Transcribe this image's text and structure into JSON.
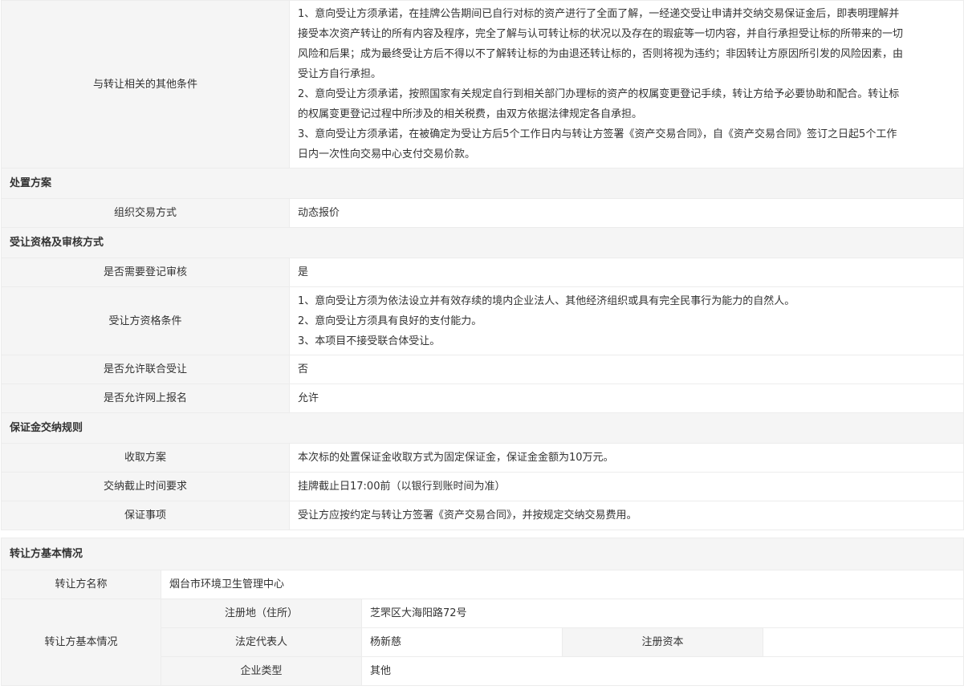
{
  "other_conditions": {
    "label": "与转让相关的其他条件",
    "lines": [
      "1、意向受让方须承诺，在挂牌公告期间已自行对标的资产进行了全面了解，一经递交受让申请并交纳交易保证金后，即表明理解并",
      "接受本次资产转让的所有内容及程序，完全了解与认可转让标的状况以及存在的瑕疵等一切内容，并自行承担受让标的所带来的一切",
      "风险和后果；成为最终受让方后不得以不了解转让标的为由退还转让标的，否则将视为违约；非因转让方原因所引发的风险因素，由",
      "受让方自行承担。",
      "2、意向受让方须承诺，按照国家有关规定自行到相关部门办理标的资产的权属变更登记手续，转让方给予必要协助和配合。转让标",
      "的权属变更登记过程中所涉及的相关税费，由双方依据法律规定各自承担。",
      "3、意向受让方须承诺，在被确定为受让方后5个工作日内与转让方签署《资产交易合同》，自《资产交易合同》签订之日起5个工作",
      "日内一次性向交易中心支付交易价款。"
    ]
  },
  "disposal": {
    "header": "处置方案",
    "method_label": "组织交易方式",
    "method_value": "动态报价"
  },
  "qualification": {
    "header": "受让资格及审核方式",
    "reg_label": "是否需要登记审核",
    "reg_value": "是",
    "cond_label": "受让方资格条件",
    "cond_lines": [
      "1、意向受让方须为依法设立并有效存续的境内企业法人、其他经济组织或具有完全民事行为能力的自然人。",
      "2、意向受让方须具有良好的支付能力。",
      "3、本项目不接受联合体受让。"
    ],
    "joint_label": "是否允许联合受让",
    "joint_value": "否",
    "online_label": "是否允许网上报名",
    "online_value": "允许"
  },
  "deposit": {
    "header": "保证金交纳规则",
    "plan_label": "收取方案",
    "plan_value": "本次标的处置保证金收取方式为固定保证金，保证金金额为10万元。",
    "deadline_label": "交纳截止时间要求",
    "deadline_value": "挂牌截止日17:00前（以银行到账时间为准）",
    "items_label": "保证事项",
    "items_value": "受让方应按约定与转让方签署《资产交易合同》，并按规定交纳交易费用。"
  },
  "transferor": {
    "header": "转让方基本情况",
    "name_label": "转让方名称",
    "name_value": "烟台市环境卫生管理中心",
    "basic_label": "转让方基本情况",
    "address_label": "注册地（住所）",
    "address_value": "芝罘区大海阳路72号",
    "legal_rep_label": "法定代表人",
    "legal_rep_value": "杨新慈",
    "capital_label": "注册资本",
    "capital_value": "",
    "type_label": "企业类型",
    "type_value": "其他"
  }
}
